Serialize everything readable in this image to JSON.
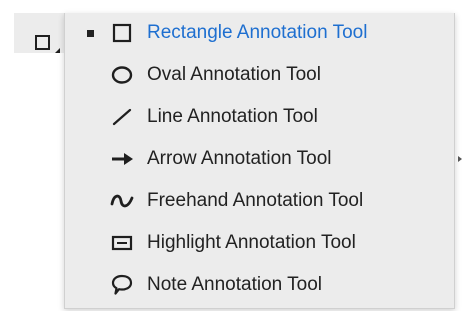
{
  "menu": {
    "selected_index": 0,
    "items": [
      {
        "label": "Rectangle Annotation Tool",
        "icon": "rectangle-icon",
        "selected": true
      },
      {
        "label": "Oval Annotation Tool",
        "icon": "oval-icon",
        "selected": false
      },
      {
        "label": "Line Annotation Tool",
        "icon": "line-icon",
        "selected": false
      },
      {
        "label": "Arrow Annotation Tool",
        "icon": "arrow-icon",
        "selected": false
      },
      {
        "label": "Freehand Annotation Tool",
        "icon": "freehand-icon",
        "selected": false
      },
      {
        "label": "Highlight Annotation Tool",
        "icon": "highlight-icon",
        "selected": false
      },
      {
        "label": "Note Annotation Tool",
        "icon": "note-icon",
        "selected": false
      }
    ]
  },
  "colors": {
    "selected_text": "#1e6fd0",
    "menu_background": "#ececec",
    "text": "#222222"
  }
}
